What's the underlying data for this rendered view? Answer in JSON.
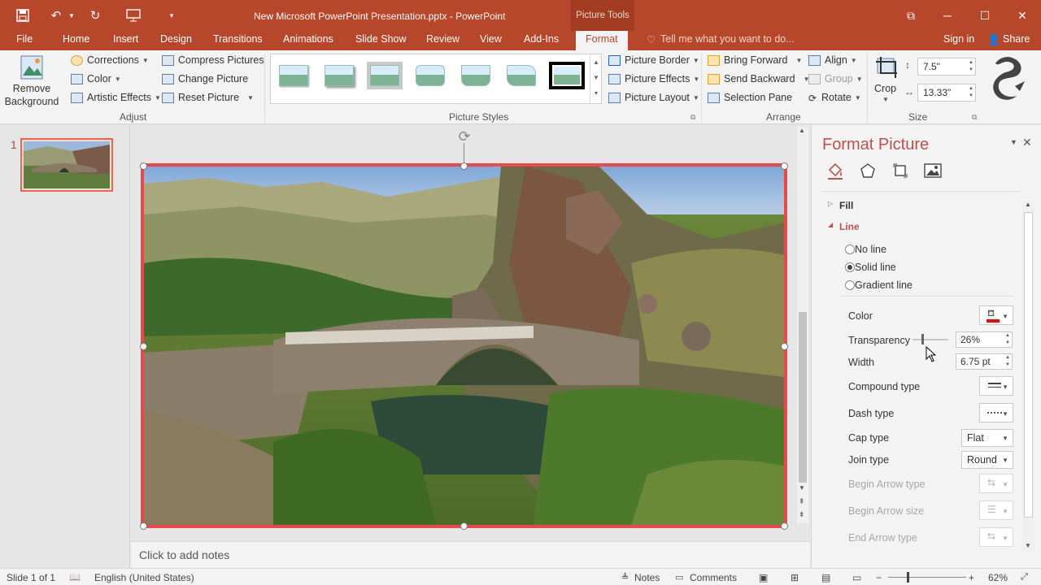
{
  "window": {
    "title": "New Microsoft PowerPoint Presentation.pptx - PowerPoint",
    "tools_tag": "Picture Tools"
  },
  "tabs": [
    "File",
    "Home",
    "Insert",
    "Design",
    "Transitions",
    "Animations",
    "Slide Show",
    "Review",
    "View",
    "Add-Ins",
    "Format"
  ],
  "active_tab": "Format",
  "tell_me": "Tell me what you want to do...",
  "sign_in": "Sign in",
  "share": "Share",
  "ribbon": {
    "adjust": {
      "remove_bg_1": "Remove",
      "remove_bg_2": "Background",
      "corrections": "Corrections",
      "color": "Color",
      "artistic": "Artistic Effects",
      "compress": "Compress Pictures",
      "change": "Change Picture",
      "reset": "Reset Picture",
      "label": "Adjust"
    },
    "picture_styles": {
      "label": "Picture Styles",
      "border": "Picture Border",
      "effects": "Picture Effects",
      "layout": "Picture Layout"
    },
    "arrange": {
      "label": "Arrange",
      "bring_forward": "Bring Forward",
      "send_backward": "Send Backward",
      "selection_pane": "Selection Pane",
      "align": "Align",
      "group": "Group",
      "rotate": "Rotate"
    },
    "size": {
      "label": "Size",
      "crop": "Crop",
      "height": "7.5\"",
      "width": "13.33\""
    }
  },
  "slides": {
    "number": "1"
  },
  "notes_placeholder": "Click to add notes",
  "format_pane": {
    "title": "Format Picture",
    "fill": "Fill",
    "line": "Line",
    "options": [
      "No line",
      "Solid line",
      "Gradient line"
    ],
    "selected_option": "Solid line",
    "color_label": "Color",
    "line_color": "#ff0000",
    "transparency_label": "Transparency",
    "transparency_value": "26%",
    "transparency_level": 0.26,
    "width_label": "Width",
    "width_value": "6.75 pt",
    "compound_label": "Compound type",
    "dash_label": "Dash type",
    "cap_label": "Cap type",
    "cap_value": "Flat",
    "join_label": "Join type",
    "join_value": "Round",
    "begin_arrow_type": "Begin Arrow type",
    "begin_arrow_size": "Begin Arrow size",
    "end_arrow_type": "End Arrow type"
  },
  "status": {
    "slide": "Slide 1 of 1",
    "language": "English (United States)",
    "notes": "Notes",
    "comments": "Comments",
    "zoom": "62%"
  },
  "colors": {
    "accent": "#b7472a",
    "selection_border": "#e8494a"
  }
}
